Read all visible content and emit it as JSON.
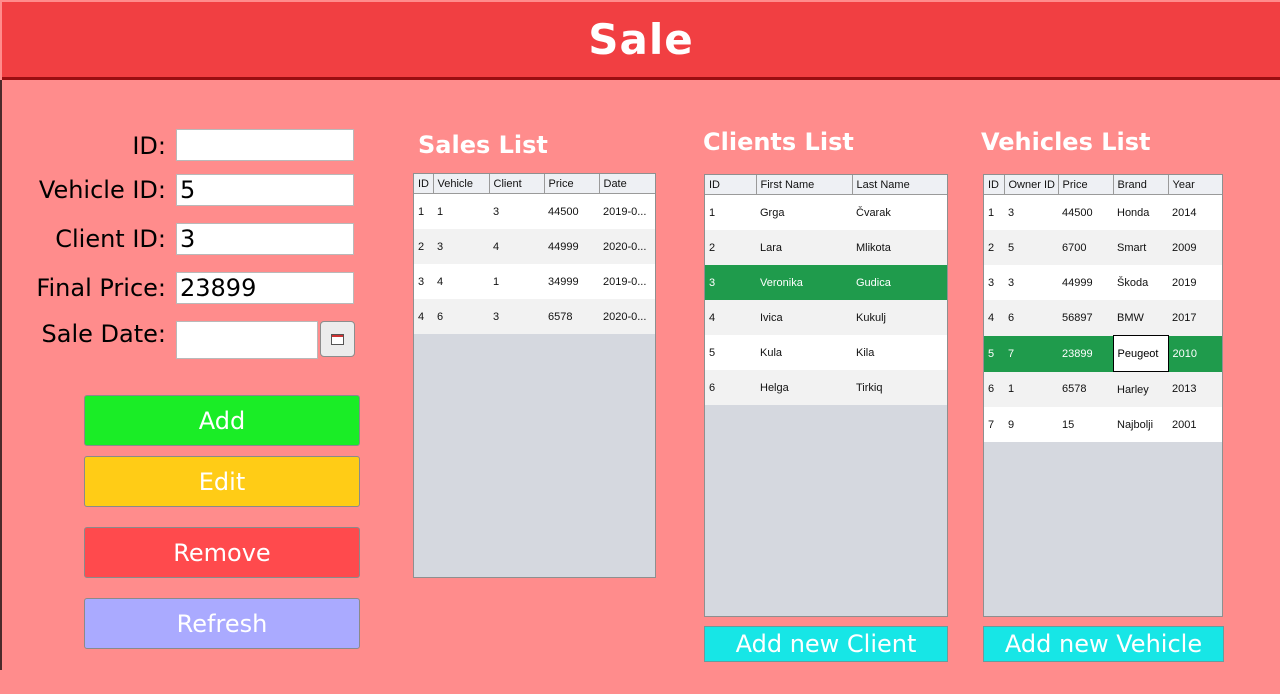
{
  "header": {
    "title": "Sale"
  },
  "form": {
    "id_label": "ID:",
    "id_value": "",
    "vehicle_label": "Vehicle ID:",
    "vehicle_value": "5",
    "client_label": "Client ID:",
    "client_value": "3",
    "price_label": "Final Price:",
    "price_value": "23899",
    "date_label": "Sale Date:",
    "date_value": ""
  },
  "buttons": {
    "add": "Add",
    "edit": "Edit",
    "remove": "Remove",
    "refresh": "Refresh"
  },
  "sales": {
    "title": "Sales List",
    "headers": [
      "ID",
      "Vehicle",
      "Client",
      "Price",
      "Date"
    ],
    "rows": [
      [
        "1",
        "1",
        "3",
        "44500",
        "2019-0..."
      ],
      [
        "2",
        "3",
        "4",
        "44999",
        "2020-0..."
      ],
      [
        "3",
        "4",
        "1",
        "34999",
        "2019-0..."
      ],
      [
        "4",
        "6",
        "3",
        "6578",
        "2020-0..."
      ]
    ]
  },
  "clients": {
    "title": "Clients List",
    "headers": [
      "ID",
      "First Name",
      "Last Name"
    ],
    "rows": [
      [
        "1",
        "Grga",
        "Čvarak"
      ],
      [
        "2",
        "Lara",
        "Mlikota"
      ],
      [
        "3",
        "Veronika",
        "Gudica"
      ],
      [
        "4",
        "Ivica",
        "Kukulj"
      ],
      [
        "5",
        "Kula",
        "Kila"
      ],
      [
        "6",
        "Helga",
        "Tirkiq"
      ]
    ],
    "selected_row": 3,
    "add_button": "Add new Client"
  },
  "vehicles": {
    "title": "Vehicles List",
    "headers": [
      "ID",
      "Owner ID",
      "Price",
      "Brand",
      "Year"
    ],
    "rows": [
      [
        "1",
        "3",
        "44500",
        "Honda",
        "2014"
      ],
      [
        "2",
        "5",
        "6700",
        "Smart",
        "2009"
      ],
      [
        "3",
        "3",
        "44999",
        "Škoda",
        "2019"
      ],
      [
        "4",
        "6",
        "56897",
        "BMW",
        "2017"
      ],
      [
        "5",
        "7",
        "23899",
        "Peugeot",
        "2010"
      ],
      [
        "6",
        "1",
        "6578",
        "Harley",
        "2013"
      ],
      [
        "7",
        "9",
        "15",
        "Najbolji",
        "2001"
      ]
    ],
    "selected_row": 5,
    "add_button": "Add new Vehicle"
  },
  "colors": {
    "background": "#ff8c8c",
    "header": "#f13f42",
    "add": "#1aed26",
    "edit": "#ffcc16",
    "remove": "#ff4a4d",
    "refresh": "#aaaaff",
    "selection": "#1f9b4c",
    "cyan": "#17e6e6"
  },
  "icons": {
    "date_picker": "calendar-icon"
  }
}
